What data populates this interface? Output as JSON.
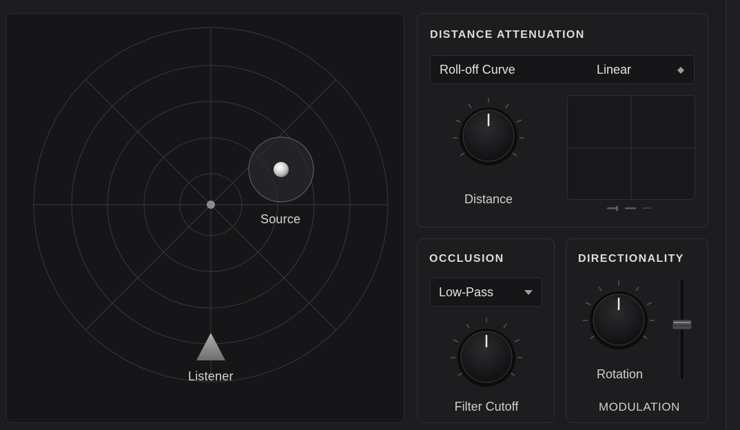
{
  "radar": {
    "source_label": "Source",
    "listener_label": "Listener"
  },
  "distance_attenuation": {
    "title": "DISTANCE ATTENUATION",
    "rolloff_label": "Roll-off Curve",
    "rolloff_value": "Linear",
    "knob_label": "Distance"
  },
  "occlusion": {
    "title": "OCCLUSION",
    "filter_type": "Low-Pass",
    "knob_label": "Filter Cutoff"
  },
  "directionality": {
    "title": "DIRECTIONALITY",
    "knob_label": "Rotation",
    "footer_label": "MODULATION"
  },
  "colors": {
    "background": "#1c1c1e",
    "panel": "#1d1d20",
    "accent_text": "#dcdcdc"
  },
  "icons": [
    "diamond-sort-icon",
    "chevron-down-icon",
    "listener-triangle-icon"
  ]
}
